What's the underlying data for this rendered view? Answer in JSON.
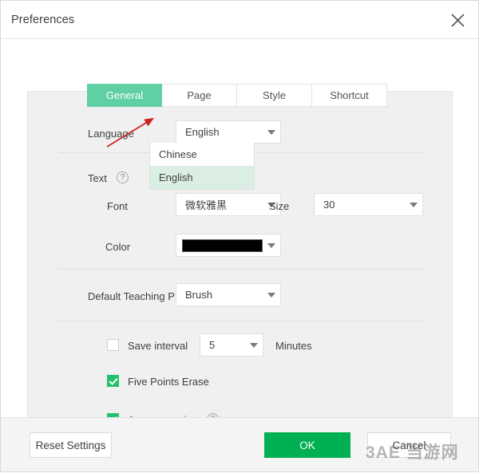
{
  "window": {
    "title": "Preferences",
    "close_icon": "close-icon"
  },
  "tabs": [
    {
      "label": "General",
      "active": true
    },
    {
      "label": "Page",
      "active": false
    },
    {
      "label": "Style",
      "active": false
    },
    {
      "label": "Shortcut",
      "active": false
    }
  ],
  "form": {
    "language": {
      "label": "Language",
      "value": "English",
      "expanded": true,
      "options": [
        {
          "label": "Chinese",
          "selected": false
        },
        {
          "label": "English",
          "selected": true
        }
      ]
    },
    "text_section": {
      "label": "Text",
      "help_icon": "question-mark-icon",
      "help_glyph": "?"
    },
    "font": {
      "label": "Font",
      "value": "微软雅黑"
    },
    "size": {
      "label": "Size",
      "value": "30"
    },
    "color": {
      "label": "Color",
      "value": "#000000"
    },
    "default_teaching": {
      "label": "Default Teaching P",
      "value": "Brush"
    },
    "save_interval": {
      "label": "Save interval",
      "checked": false,
      "value": "5",
      "unit": "Minutes"
    },
    "five_points_erase": {
      "label": "Five Points Erase",
      "checked": true
    },
    "area_recognize": {
      "label": "Area recognize",
      "checked": true,
      "help_icon": "question-mark-icon",
      "help_glyph": "?"
    }
  },
  "footer": {
    "reset_label": "Reset Settings",
    "ok_label": "OK",
    "cancel_label": "Cancel"
  },
  "watermark": {
    "text": "3AE 当游网"
  },
  "colors": {
    "tab_active": "#5fcfa4",
    "ok_button": "#00b053",
    "checkbox_checked": "#25c16a",
    "option_selected": "#daeee4",
    "annotation_arrow": "#cc2222"
  }
}
